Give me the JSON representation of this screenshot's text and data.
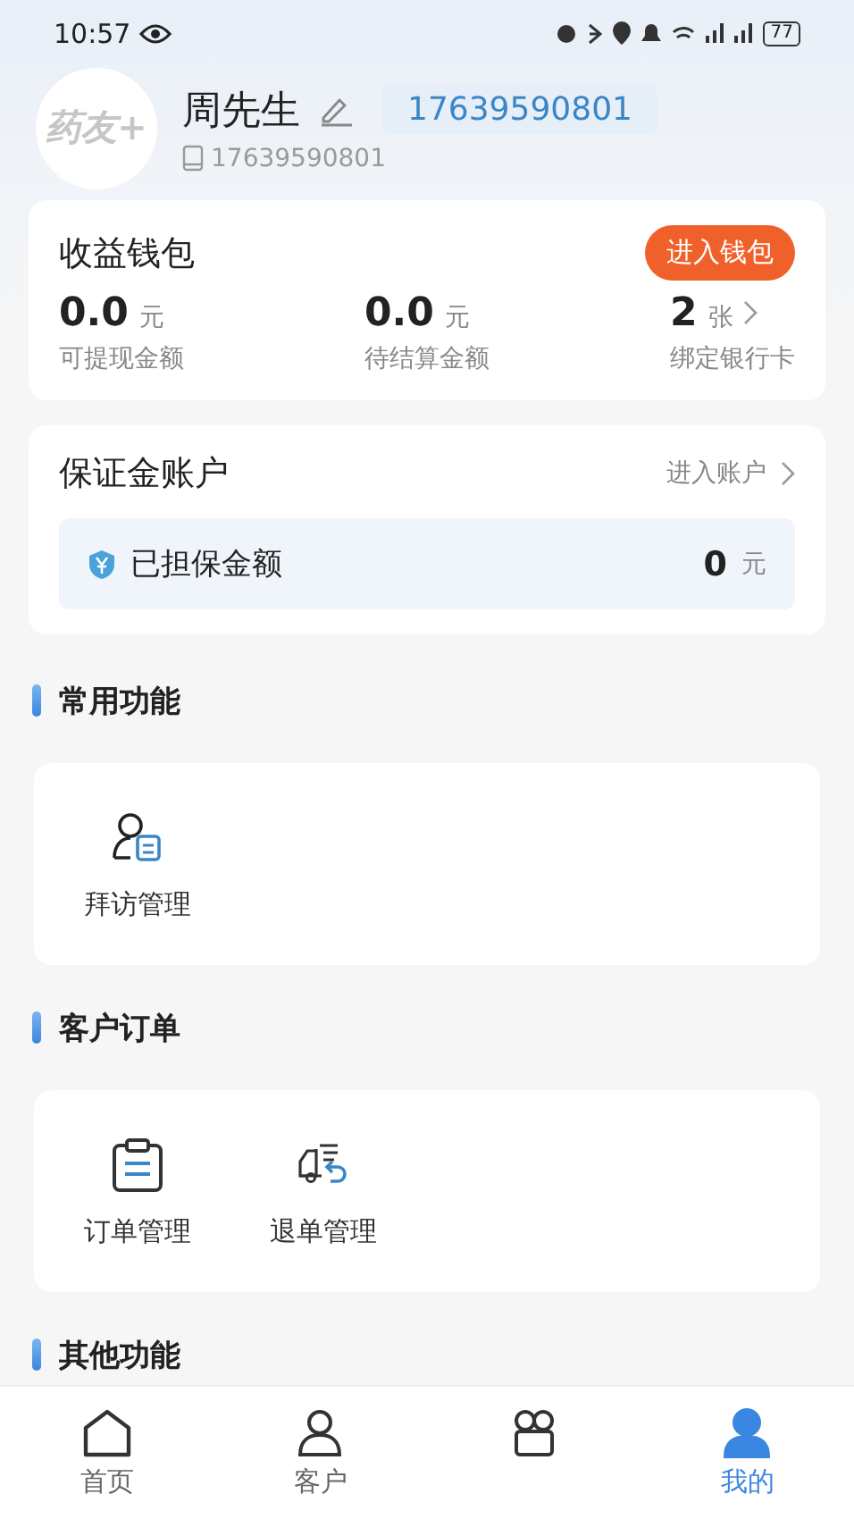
{
  "status_bar": {
    "time": "10:57",
    "battery": "77"
  },
  "profile": {
    "logo": "药友+",
    "name": "周先生",
    "phone_badge": "17639590801",
    "phone": "17639590801"
  },
  "wallet": {
    "title": "收益钱包",
    "button": "进入钱包",
    "stats": [
      {
        "value": "0.0",
        "unit": "元",
        "label": "可提现金额",
        "link": false
      },
      {
        "value": "0.0",
        "unit": "元",
        "label": "待结算金额",
        "link": false
      },
      {
        "value": "2",
        "unit": "张",
        "label": "绑定银行卡",
        "link": true
      }
    ]
  },
  "deposit": {
    "title": "保证金账户",
    "link": "进入账户",
    "row": {
      "label": "已担保金额",
      "value": "0",
      "unit": "元"
    }
  },
  "sections": [
    {
      "title": "常用功能",
      "items": [
        {
          "label": "拜访管理",
          "kind": "visit"
        }
      ]
    },
    {
      "title": "客户订单",
      "items": [
        {
          "label": "订单管理",
          "kind": "order"
        },
        {
          "label": "退单管理",
          "kind": "return"
        }
      ]
    },
    {
      "title": "其他功能"
    }
  ],
  "nav": [
    {
      "label": "首页",
      "kind": "home",
      "selected": false
    },
    {
      "label": "客户",
      "kind": "customer",
      "selected": false
    },
    {
      "kind": "gift",
      "selected": false
    },
    {
      "label": "我的",
      "kind": "me",
      "selected": true
    }
  ]
}
